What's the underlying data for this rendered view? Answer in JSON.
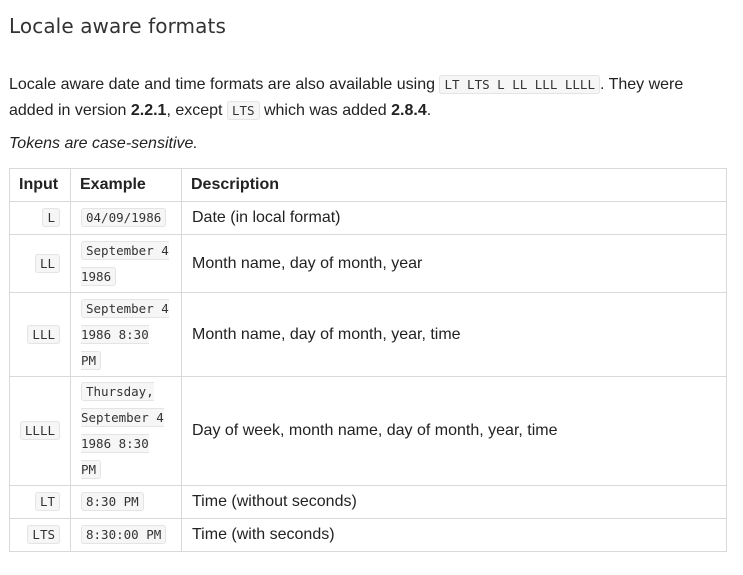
{
  "section": {
    "title": "Locale aware formats"
  },
  "intro": {
    "text_before": "Locale aware date and time formats are also available using ",
    "tokens_code": "LT LTS L LL LLL LLLL",
    "text_after_tokens": ". They were added in version ",
    "version_main": "2.2.1",
    "text_except": ", except ",
    "lts_code": "LTS",
    "text_which": " which was added ",
    "version_lts": "2.8.4",
    "text_end": "."
  },
  "note": "Tokens are case-sensitive.",
  "table": {
    "headers": [
      "Input",
      "Example",
      "Description"
    ],
    "rows": [
      {
        "input": "L",
        "example": "04/09/1986",
        "description": "Date (in local format)"
      },
      {
        "input": "LL",
        "example": "September 4 1986",
        "description": "Month name, day of month, year"
      },
      {
        "input": "LLL",
        "example": "September 4 1986 8:30 PM",
        "description": "Month name, day of month, year, time"
      },
      {
        "input": "LLLL",
        "example": "Thursday, September 4 1986 8:30 PM",
        "description": "Day of week, month name, day of month, year, time"
      },
      {
        "input": "LT",
        "example": "8:30 PM",
        "description": "Time (without seconds)"
      },
      {
        "input": "LTS",
        "example": "8:30:00 PM",
        "description": "Time (with seconds)"
      }
    ]
  }
}
